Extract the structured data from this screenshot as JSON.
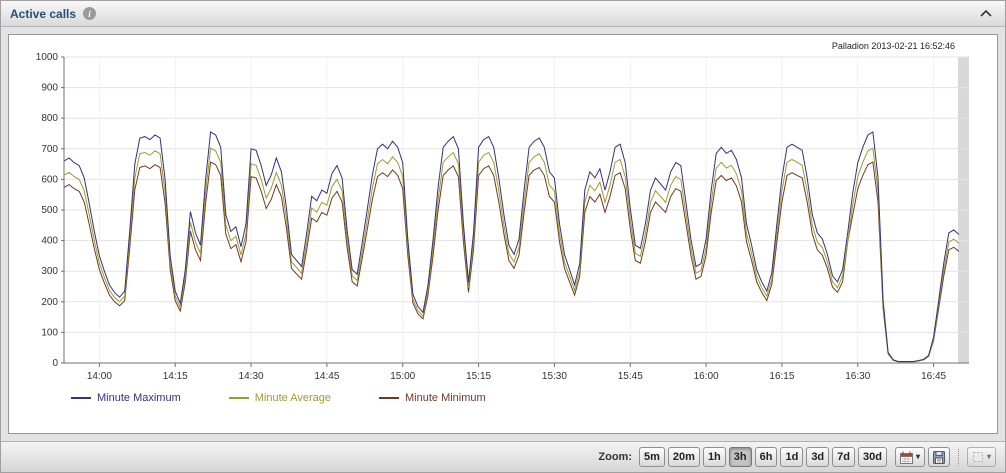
{
  "header": {
    "title": "Active calls"
  },
  "icons": {
    "info": "i",
    "caret": "▾"
  },
  "chart": {
    "watermark": "Palladion 2013-02-21 16:52:46"
  },
  "chart_data": {
    "type": "line",
    "title": "Active calls",
    "x_start": "13:53",
    "x_interval_minutes": 1,
    "x_axis_span_minutes": 179,
    "x_tick_labels": [
      "14:00",
      "14:15",
      "14:30",
      "14:45",
      "15:00",
      "15:15",
      "15:30",
      "15:45",
      "16:00",
      "16:15",
      "16:30",
      "16:45"
    ],
    "x_tick_offsets_min": [
      7,
      22,
      37,
      52,
      67,
      82,
      97,
      112,
      127,
      142,
      157,
      172
    ],
    "ylim": [
      0,
      1000
    ],
    "y_tick_step": 100,
    "grid": true,
    "legend_position": "bottom",
    "series": [
      {
        "name": "Minute Maximum",
        "color": "#32327e",
        "values": [
          660,
          670,
          655,
          645,
          605,
          520,
          430,
          350,
          300,
          255,
          230,
          215,
          235,
          430,
          650,
          735,
          740,
          730,
          745,
          735,
          600,
          350,
          235,
          195,
          305,
          495,
          425,
          385,
          600,
          755,
          745,
          705,
          485,
          430,
          445,
          380,
          455,
          700,
          695,
          645,
          580,
          615,
          670,
          625,
          505,
          355,
          335,
          315,
          425,
          545,
          530,
          565,
          555,
          620,
          645,
          605,
          435,
          305,
          290,
          395,
          505,
          615,
          700,
          715,
          700,
          725,
          705,
          655,
          405,
          225,
          185,
          165,
          255,
          405,
          575,
          705,
          725,
          740,
          700,
          455,
          265,
          425,
          705,
          730,
          740,
          705,
          605,
          485,
          385,
          355,
          405,
          565,
          705,
          725,
          735,
          705,
          625,
          605,
          455,
          355,
          305,
          255,
          325,
          565,
          625,
          605,
          635,
          565,
          625,
          705,
          715,
          655,
          505,
          385,
          375,
          455,
          565,
          605,
          585,
          565,
          625,
          655,
          645,
          525,
          405,
          315,
          325,
          405,
          565,
          685,
          705,
          685,
          695,
          665,
          605,
          455,
          385,
          305,
          265,
          235,
          295,
          455,
          605,
          705,
          715,
          705,
          695,
          605,
          485,
          425,
          405,
          355,
          285,
          265,
          305,
          425,
          555,
          655,
          705,
          745,
          755,
          605,
          205,
          35,
          10,
          5,
          5,
          5,
          5,
          8,
          12,
          25,
          85,
          205,
          325,
          425,
          435,
          420
        ]
      },
      {
        "name": "Minute Average",
        "color": "#a29a2f",
        "values": [
          614,
          623,
          609,
          600,
          563,
          484,
          400,
          326,
          279,
          237,
          214,
          200,
          219,
          400,
          605,
          684,
          688,
          679,
          693,
          684,
          558,
          326,
          219,
          181,
          284,
          460,
          395,
          358,
          558,
          702,
          693,
          656,
          451,
          400,
          414,
          353,
          423,
          651,
          646,
          600,
          539,
          572,
          623,
          581,
          470,
          330,
          312,
          293,
          395,
          507,
          493,
          525,
          516,
          577,
          600,
          563,
          405,
          284,
          270,
          367,
          470,
          572,
          651,
          665,
          651,
          674,
          656,
          609,
          377,
          209,
          172,
          153,
          237,
          377,
          535,
          656,
          674,
          688,
          651,
          423,
          246,
          395,
          656,
          679,
          688,
          656,
          563,
          451,
          358,
          330,
          377,
          525,
          656,
          674,
          684,
          656,
          581,
          563,
          423,
          330,
          284,
          237,
          302,
          525,
          581,
          563,
          591,
          525,
          581,
          656,
          665,
          609,
          470,
          358,
          349,
          423,
          525,
          563,
          544,
          525,
          581,
          609,
          600,
          488,
          377,
          293,
          302,
          377,
          525,
          637,
          656,
          637,
          646,
          618,
          563,
          423,
          358,
          284,
          246,
          219,
          274,
          423,
          563,
          656,
          665,
          656,
          646,
          563,
          451,
          395,
          377,
          330,
          265,
          246,
          284,
          395,
          516,
          609,
          656,
          693,
          702,
          563,
          191,
          33,
          9,
          5,
          5,
          5,
          5,
          7,
          11,
          23,
          79,
          191,
          302,
          395,
          405,
          391
        ]
      },
      {
        "name": "Minute Minimum",
        "color": "#6f3a23",
        "values": [
          574,
          583,
          570,
          561,
          526,
          452,
          374,
          305,
          261,
          222,
          200,
          187,
          204,
          374,
          566,
          639,
          644,
          635,
          648,
          639,
          522,
          305,
          204,
          170,
          265,
          431,
          370,
          335,
          522,
          657,
          648,
          613,
          422,
          374,
          387,
          331,
          396,
          609,
          605,
          561,
          505,
          535,
          583,
          544,
          439,
          309,
          291,
          274,
          370,
          474,
          461,
          492,
          483,
          539,
          561,
          526,
          378,
          265,
          252,
          344,
          439,
          535,
          609,
          622,
          609,
          631,
          613,
          570,
          352,
          196,
          161,
          144,
          222,
          352,
          500,
          613,
          631,
          644,
          609,
          396,
          231,
          370,
          613,
          635,
          644,
          613,
          526,
          422,
          335,
          309,
          352,
          492,
          613,
          631,
          639,
          613,
          544,
          526,
          396,
          309,
          265,
          222,
          283,
          492,
          544,
          526,
          552,
          492,
          544,
          613,
          622,
          570,
          439,
          335,
          326,
          396,
          492,
          526,
          509,
          492,
          544,
          570,
          561,
          457,
          352,
          274,
          283,
          352,
          492,
          596,
          613,
          596,
          605,
          579,
          526,
          396,
          335,
          265,
          231,
          204,
          257,
          396,
          526,
          613,
          622,
          613,
          605,
          526,
          422,
          370,
          352,
          309,
          248,
          231,
          265,
          396,
          483,
          570,
          613,
          648,
          657,
          526,
          178,
          30,
          9,
          4,
          4,
          4,
          4,
          7,
          10,
          22,
          74,
          178,
          283,
          370,
          378,
          365
        ]
      }
    ]
  },
  "toolbar": {
    "zoom_label": "Zoom:",
    "zoom_levels": [
      "5m",
      "20m",
      "1h",
      "3h",
      "6h",
      "1d",
      "3d",
      "7d",
      "30d"
    ],
    "active_zoom": "3h"
  }
}
